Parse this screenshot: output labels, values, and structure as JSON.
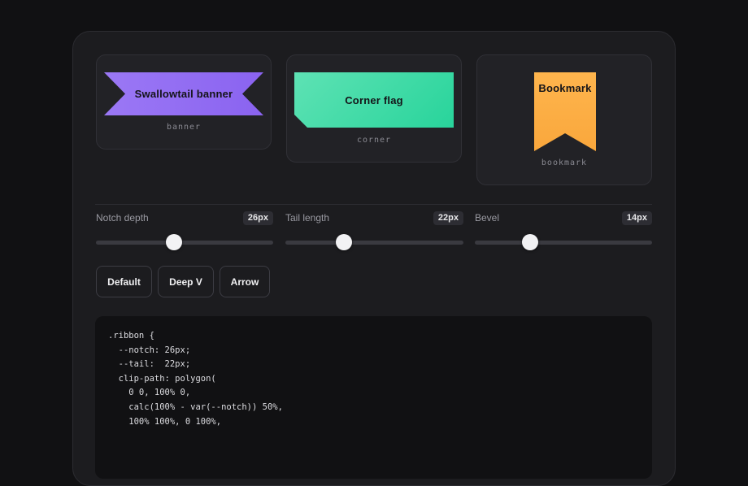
{
  "shapes": [
    {
      "label": "Swallowtail banner",
      "caption": "banner"
    },
    {
      "label": "Corner flag",
      "caption": "corner"
    },
    {
      "label": "Bookmark",
      "caption": "bookmark"
    }
  ],
  "sliders": [
    {
      "label": "Notch depth",
      "value_text": "26px",
      "value": 26,
      "fraction": 0.44
    },
    {
      "label": "Tail length",
      "value_text": "22px",
      "value": 22,
      "fraction": 0.33
    },
    {
      "label": "Bevel",
      "value_text": "14px",
      "value": 14,
      "fraction": 0.31
    }
  ],
  "presets": [
    "Default",
    "Deep V",
    "Arrow"
  ],
  "code": ".ribbon {\n  --notch: 26px;\n  --tail:  22px;\n  clip-path: polygon(\n    0 0, 100% 0,\n    calc(100% - var(--notch)) 50%,\n    100% 100%, 0 100%,",
  "colors": {
    "banner": "#8a63f0",
    "corner": "#28d49b",
    "bookmark": "#f9a73c",
    "panel": "#1c1c1f"
  }
}
